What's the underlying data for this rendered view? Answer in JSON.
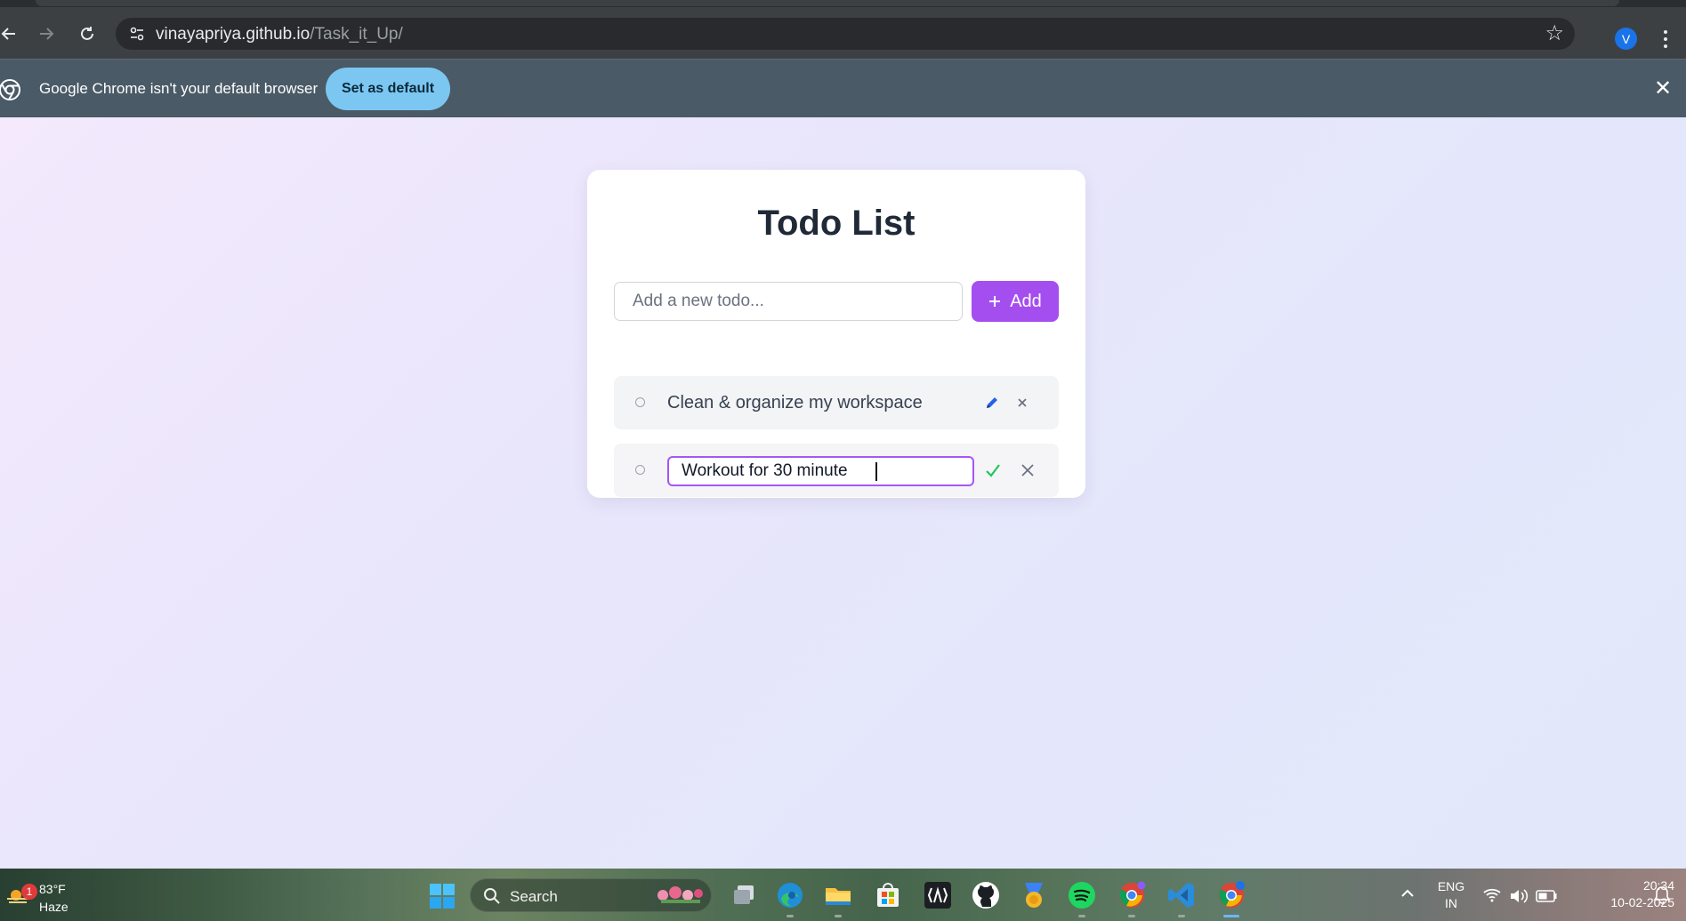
{
  "browser": {
    "url_host": "vinayapriya.github.io",
    "url_path": "/Task_it_Up/",
    "profile_initial": "V"
  },
  "infobar": {
    "message": "Google Chrome isn't your default browser",
    "button_label": "Set as default",
    "close_glyph": "✕"
  },
  "app": {
    "title": "Todo List",
    "new_todo_placeholder": "Add a new todo...",
    "add_button_label": "Add",
    "add_button_icon": "plus-icon",
    "todos": [
      {
        "text": "Clean & organize my workspace",
        "mode": "view",
        "actions": [
          "edit-icon",
          "delete-icon"
        ]
      },
      {
        "text": "Workout for 30 minute",
        "mode": "editing",
        "actions": [
          "confirm-icon",
          "cancel-icon"
        ]
      }
    ],
    "colors": {
      "accent": "#a54ef0",
      "edit_border": "#a855f7",
      "confirm": "#22c55e",
      "edit_icon": "#2563eb"
    }
  },
  "taskbar": {
    "weather": {
      "temp": "83°F",
      "condition": "Haze",
      "badge": "1"
    },
    "search_label": "Search",
    "pinned_apps": [
      "task-view-icon",
      "edge-icon",
      "file-explorer-icon",
      "microsoft-store-icon",
      "code-terminal-icon",
      "github-icon",
      "badge-app-icon",
      "spotify-icon",
      "chrome-icon",
      "vscode-icon",
      "chrome-profile-icon"
    ],
    "language_line1": "ENG",
    "language_line2": "IN",
    "time": "20:34",
    "date": "10-02-2025"
  }
}
